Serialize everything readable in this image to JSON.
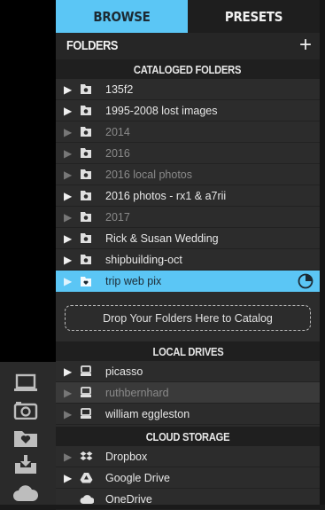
{
  "tabs": {
    "browse": "BROWSE",
    "presets": "PRESETS"
  },
  "folders_header": {
    "title": "FOLDERS",
    "add": "+"
  },
  "sections": {
    "cataloged": "CATALOGED FOLDERS",
    "local": "LOCAL DRIVES",
    "cloud": "CLOUD STORAGE"
  },
  "cataloged_folders": [
    {
      "label": "135f2",
      "state": "normal"
    },
    {
      "label": "1995-2008 lost images",
      "state": "normal"
    },
    {
      "label": "2014",
      "state": "dim"
    },
    {
      "label": "2016",
      "state": "dim"
    },
    {
      "label": "2016 local photos",
      "state": "dim"
    },
    {
      "label": "2016 photos - rx1 & a7rii",
      "state": "normal"
    },
    {
      "label": "2017",
      "state": "dim"
    },
    {
      "label": "Rick & Susan Wedding",
      "state": "normal"
    },
    {
      "label": "shipbuilding-oct",
      "state": "normal"
    },
    {
      "label": "trip web pix",
      "state": "selected"
    }
  ],
  "drop_zone": "Drop Your Folders Here to Catalog",
  "local_drives": [
    {
      "label": "picasso",
      "state": "normal"
    },
    {
      "label": "ruthbernhard",
      "state": "highlight-dim"
    },
    {
      "label": "william eggleston",
      "state": "normal"
    }
  ],
  "cloud_storage": [
    {
      "label": "Dropbox",
      "state": "normal"
    },
    {
      "label": "Google Drive",
      "state": "normal"
    },
    {
      "label": "OneDrive",
      "state": "normal"
    }
  ],
  "side_icons": [
    "laptop-icon",
    "camera-icon",
    "favorite-folder-icon",
    "inbox-download-icon",
    "cloud-icon"
  ],
  "colors": {
    "accent": "#5bc6f5",
    "panel": "#2c2c2c",
    "sidebar": "#000000"
  }
}
